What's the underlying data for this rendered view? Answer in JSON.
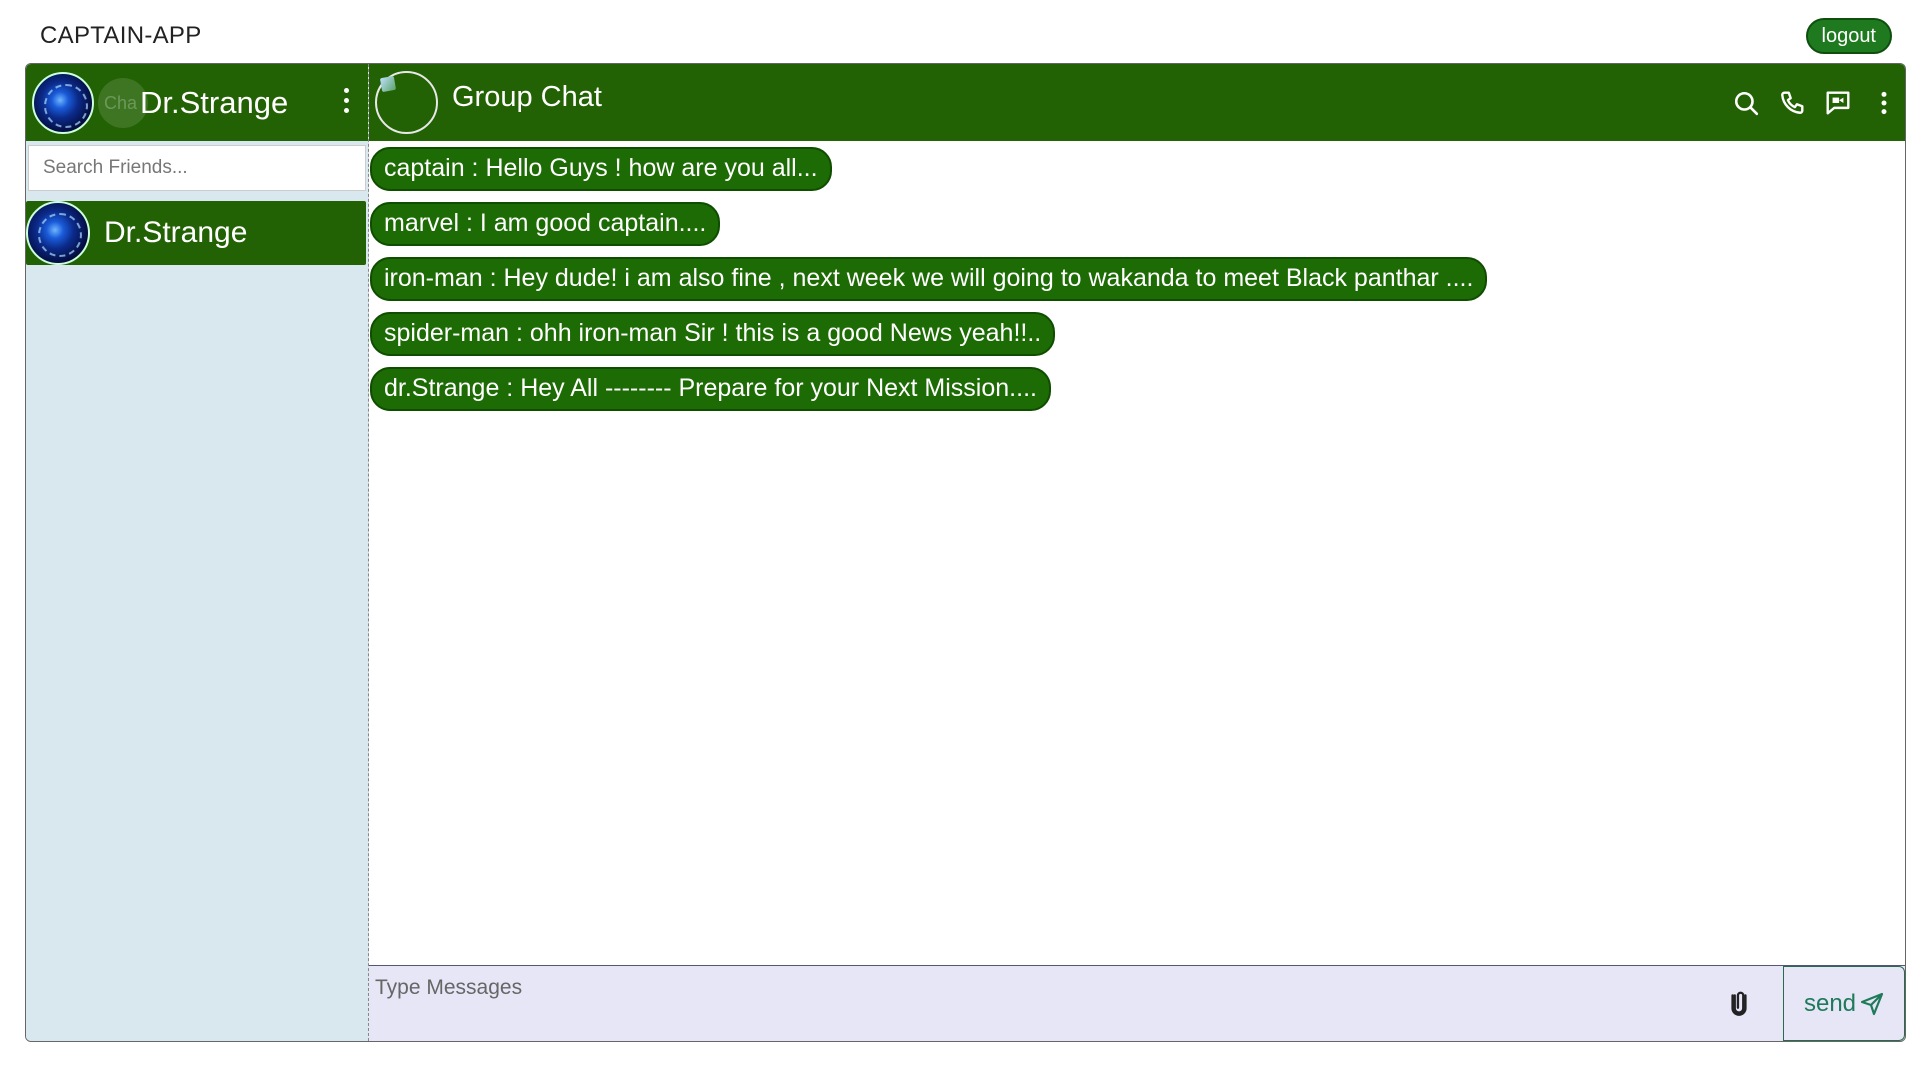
{
  "app": {
    "title": "CAPTAIN-APP",
    "logout_label": "logout"
  },
  "sidebar": {
    "user_name": "Dr.Strange",
    "ghost_text": "Cha",
    "search_placeholder": "Search Friends...",
    "friends": [
      {
        "name": "Dr.Strange"
      }
    ]
  },
  "chat": {
    "title": "Group Chat",
    "icons": [
      "search-icon",
      "phone-icon",
      "video-message-icon",
      "more-vertical-icon"
    ],
    "messages": [
      "captain : Hello Guys ! how are you all...",
      "marvel : I am good captain....",
      "iron-man : Hey dude! i am also fine , next week we will going to wakanda to meet Black panthar ....",
      "spider-man : ohh iron-man Sir ! this is a good News yeah!!..",
      "dr.Strange : Hey All -------- Prepare for your Next Mission...."
    ],
    "input_placeholder": "Type Messages",
    "send_label": "send"
  },
  "colors": {
    "header_green": "#236204",
    "bubble_green": "#1d6b04",
    "sidebar_bg": "#d9e8ef",
    "composer_bg": "#e6e6f7"
  }
}
